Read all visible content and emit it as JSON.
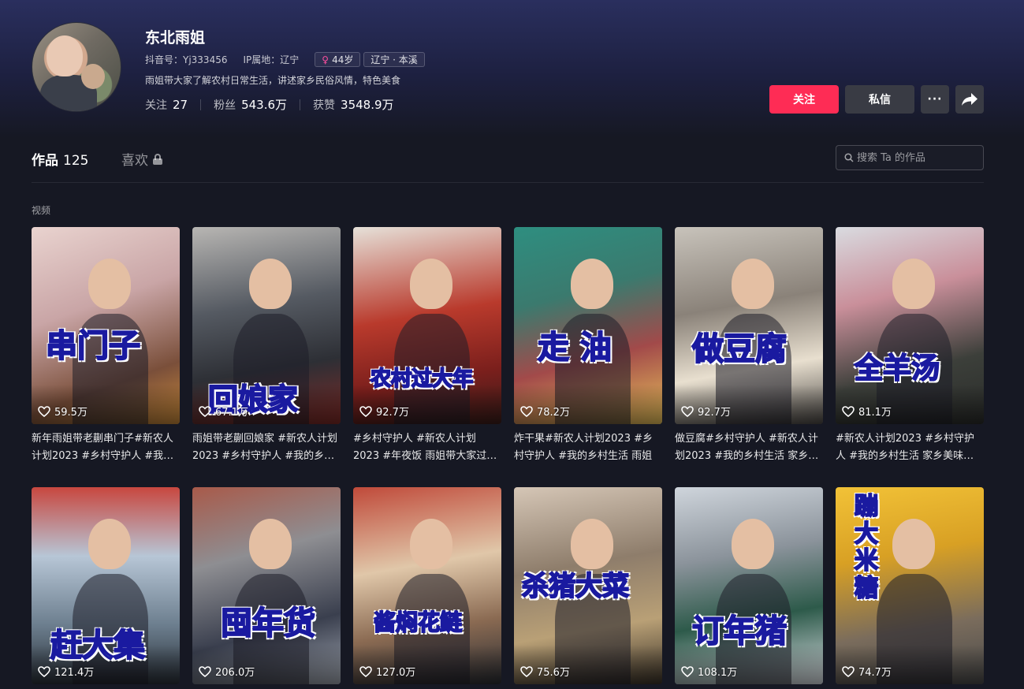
{
  "profile": {
    "name": "东北雨姐",
    "douyin_id": "抖音号：Yj333456",
    "ip": "IP属地：辽宁",
    "age_tag": "44岁",
    "location_tag": "辽宁 · 本溪",
    "bio": "雨姐带大家了解农村日常生活，讲述家乡民俗风情，特色美食",
    "stats": {
      "following_label": "关注",
      "following": "27",
      "fans_label": "粉丝",
      "fans": "543.6万",
      "likes_label": "获赞",
      "likes": "3548.9万"
    }
  },
  "actions": {
    "follow": "关注",
    "message": "私信",
    "more": "···"
  },
  "tabs": {
    "works_label": "作品",
    "works_count": "125",
    "likes_label": "喜欢"
  },
  "search": {
    "placeholder": "搜索 Ta 的作品"
  },
  "section_label": "视频",
  "videos": [
    {
      "overlay": "串门子",
      "likes": "59.5万",
      "desc": "新年雨姐带老蒯串门子#新农人计划2023 #乡村守护人 #我的乡村生活"
    },
    {
      "overlay": "回娘家",
      "likes": "67.1万",
      "desc": "雨姐带老蒯回娘家 #新农人计划2023 #乡村守护人 #我的乡村生活"
    },
    {
      "overlay": "农村过大年",
      "likes": "92.7万",
      "desc": "#乡村守护人 #新农人计划2023 #年夜饭 雨姐带大家过大年"
    },
    {
      "overlay": "走 油",
      "likes": "78.2万",
      "desc": "炸干果#新农人计划2023 #乡村守护人 #我的乡村生活 雨姐"
    },
    {
      "overlay": "做豆腐",
      "likes": "92.7万",
      "desc": "做豆腐#乡村守护人 #新农人计划2023 #我的乡村生活 家乡美味"
    },
    {
      "overlay": "全羊汤",
      "likes": "81.1万",
      "desc": "#新农人计划2023 #乡村守护人 #我的乡村生活 家乡美味全羊汤"
    },
    {
      "overlay": "赶大集",
      "likes": "121.4万",
      "desc": ""
    },
    {
      "overlay": "囤年货",
      "likes": "206.0万",
      "desc": ""
    },
    {
      "overlay": "酱焖花鲢",
      "likes": "127.0万",
      "desc": ""
    },
    {
      "overlay": "杀猪大菜",
      "likes": "75.6万",
      "desc": ""
    },
    {
      "overlay": "订年猪",
      "likes": "108.1万",
      "desc": ""
    },
    {
      "overlay": "蹦大米糖",
      "likes": "74.7万",
      "desc": ""
    }
  ],
  "colors": {
    "accent": "#fe2c55",
    "background": "#161823",
    "secondary_button": "#393b44"
  },
  "icons": [
    "female-icon",
    "lock-icon",
    "search-icon",
    "heart-icon",
    "share-icon",
    "more-icon"
  ]
}
